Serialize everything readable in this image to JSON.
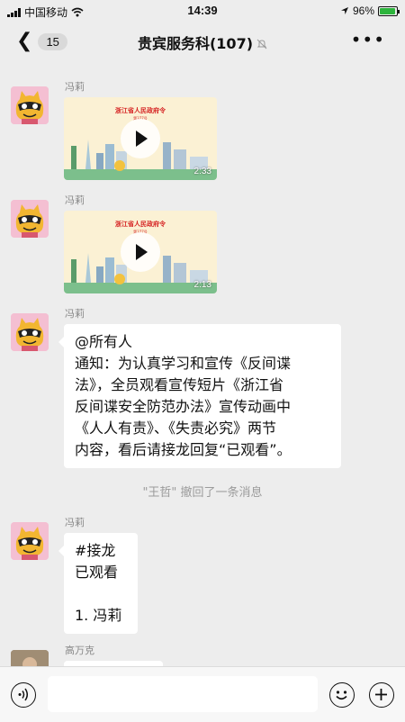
{
  "status_bar": {
    "carrier": "中国移动",
    "time": "14:39",
    "battery": "96%"
  },
  "nav": {
    "back_count": "15",
    "title": "贵宾服务科(107)"
  },
  "messages": [
    {
      "sender": "冯莉",
      "video": {
        "title": "浙江省人民政府令",
        "subtitle": "第377号",
        "duration": "2:33"
      }
    },
    {
      "sender": "冯莉",
      "video": {
        "title": "浙江省人民政府令",
        "subtitle": "第377号",
        "duration": "2:13"
      }
    },
    {
      "sender": "冯莉",
      "lines": [
        "@所有人",
        "通知：为认真学习和宣传《反间谍",
        "法》，全员观看宣传短片《浙江省",
        "反间谍安全防范办法》宣传动画中",
        "《人人有责》、《失责必究》两节",
        "内容，看后请接龙回复“已观看”。"
      ]
    },
    {
      "sender": "冯莉",
      "lines": [
        "#接龙",
        "已观看",
        "",
        "1. 冯莉"
      ]
    },
    {
      "sender": "高万克"
    }
  ],
  "system_notice": "\"王哲\" 撤回了一条消息",
  "icons": {
    "voice": "voice-icon",
    "emoji": "emoji-icon",
    "plus": "plus-icon",
    "mute": "mute-icon",
    "more": "more-icon"
  }
}
